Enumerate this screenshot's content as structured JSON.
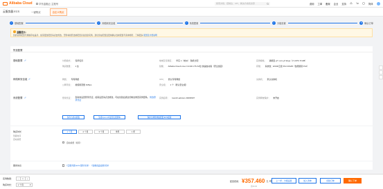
{
  "topbar": {
    "logo": "Alibaba Cloud",
    "workspace": "华东金融云 主账号",
    "search_placeholder": "搜索文档、控制台、API、解决方案和资源",
    "links": [
      "费用",
      "工单",
      "备案",
      "企业",
      "支持",
      "官网"
    ],
    "lang": "简体"
  },
  "subbar": {
    "title": "云服务器 ECS",
    "tabs": [
      "一键购买",
      "自定义购买"
    ]
  },
  "steps": [
    {
      "num": "✓",
      "label": "基础配置"
    },
    {
      "num": "✓",
      "label": "网络和安全组"
    },
    {
      "num": "✓",
      "label": "系统配置"
    },
    {
      "num": "✓",
      "label": "分组设置"
    },
    {
      "num": "5",
      "label": "确认订单"
    }
  ],
  "notice": {
    "title": "温馨提示：",
    "body": "您的实例配置与规格存在差异，如需更改配置请点击修改，否则将按照当前配置直接创建实例。建议您在配置变更前确认当前配置与需求相符，了解更多",
    "link": "配置及计费说明"
  },
  "main": {
    "header": "所选配置",
    "basic": {
      "title": "基础配置",
      "billing_k": "付费模式：",
      "billing_v": "包年包月",
      "region_k": "地域及可用区：",
      "region_v": "华东 1（杭州） 随机分配",
      "instance_k": "实例规格：",
      "instance_v": "通用型 g7 / ecs.g7.large（2 vCPU 8 GiB）",
      "count_k": "购买数量：",
      "count_v": "1 台",
      "image_k": "镜像：",
      "image_v": "Alibaba Cloud Linux 3.2104 LTS 64位 快速启动版（安全加固）",
      "disk_k": "存储：",
      "disk_v": "系统盘：ESSD云盘 PL0 40GiB（性能级别 PL0）"
    },
    "network": {
      "title": "网络和安全组",
      "net_k": "网络：",
      "net_v": "专有网络",
      "vpc_k": "VPC：",
      "vpc_v": "默认专有网络",
      "bw_k": "公网带宽：",
      "bw_v": "按使用流量 1Mbps",
      "sg_k": "安全组：",
      "sg_v": "1 个（默认安全组）",
      "eip_k": "交换机：",
      "eip_v": "默认交换机"
    },
    "system": {
      "title": "系统配置",
      "login_k": "登录凭证：",
      "login_v": "您尚未设置登录凭证，如需设置请点击修改，可在创建后通过控制台重置实例密码。",
      "login_link": "修改登录凭证",
      "hostname_k": "实例名称：",
      "hostname_v": "launch-advisor-20230907",
      "btn1": "保存为启动模板",
      "btn2": "生成Open API最佳实践脚本",
      "btn3": "保存为弹性伸缩配置 ECS模版",
      "release_k": "实例释放保护：",
      "release_v": "未开启"
    }
  },
  "period": {
    "label": "购买时长",
    "sub1": "到期时间",
    "sub2": "自动续费",
    "durations": [
      "1 个月",
      "2 个月",
      "3 个月",
      "半年",
      "1 年"
    ],
    "auto_renew": "自动续费（按月）"
  },
  "sla": {
    "label": "服务协议",
    "text": "《云服务器 ECS 服务条款》 《镜像商品使用条款》"
  },
  "footer": {
    "qty_label": "实例数量：",
    "qty_value": "1",
    "dur_label": "购买时长：",
    "dur_value": "1 个月",
    "price_label": "配置费用：",
    "price": "¥357.460",
    "price_unit": "元",
    "price_sub": "省¥0.00",
    "btn_cart": "加入清单",
    "btn_back": "上一步：分组设置",
    "btn_prev": "创建订单",
    "btn_confirm": "确认下单"
  }
}
